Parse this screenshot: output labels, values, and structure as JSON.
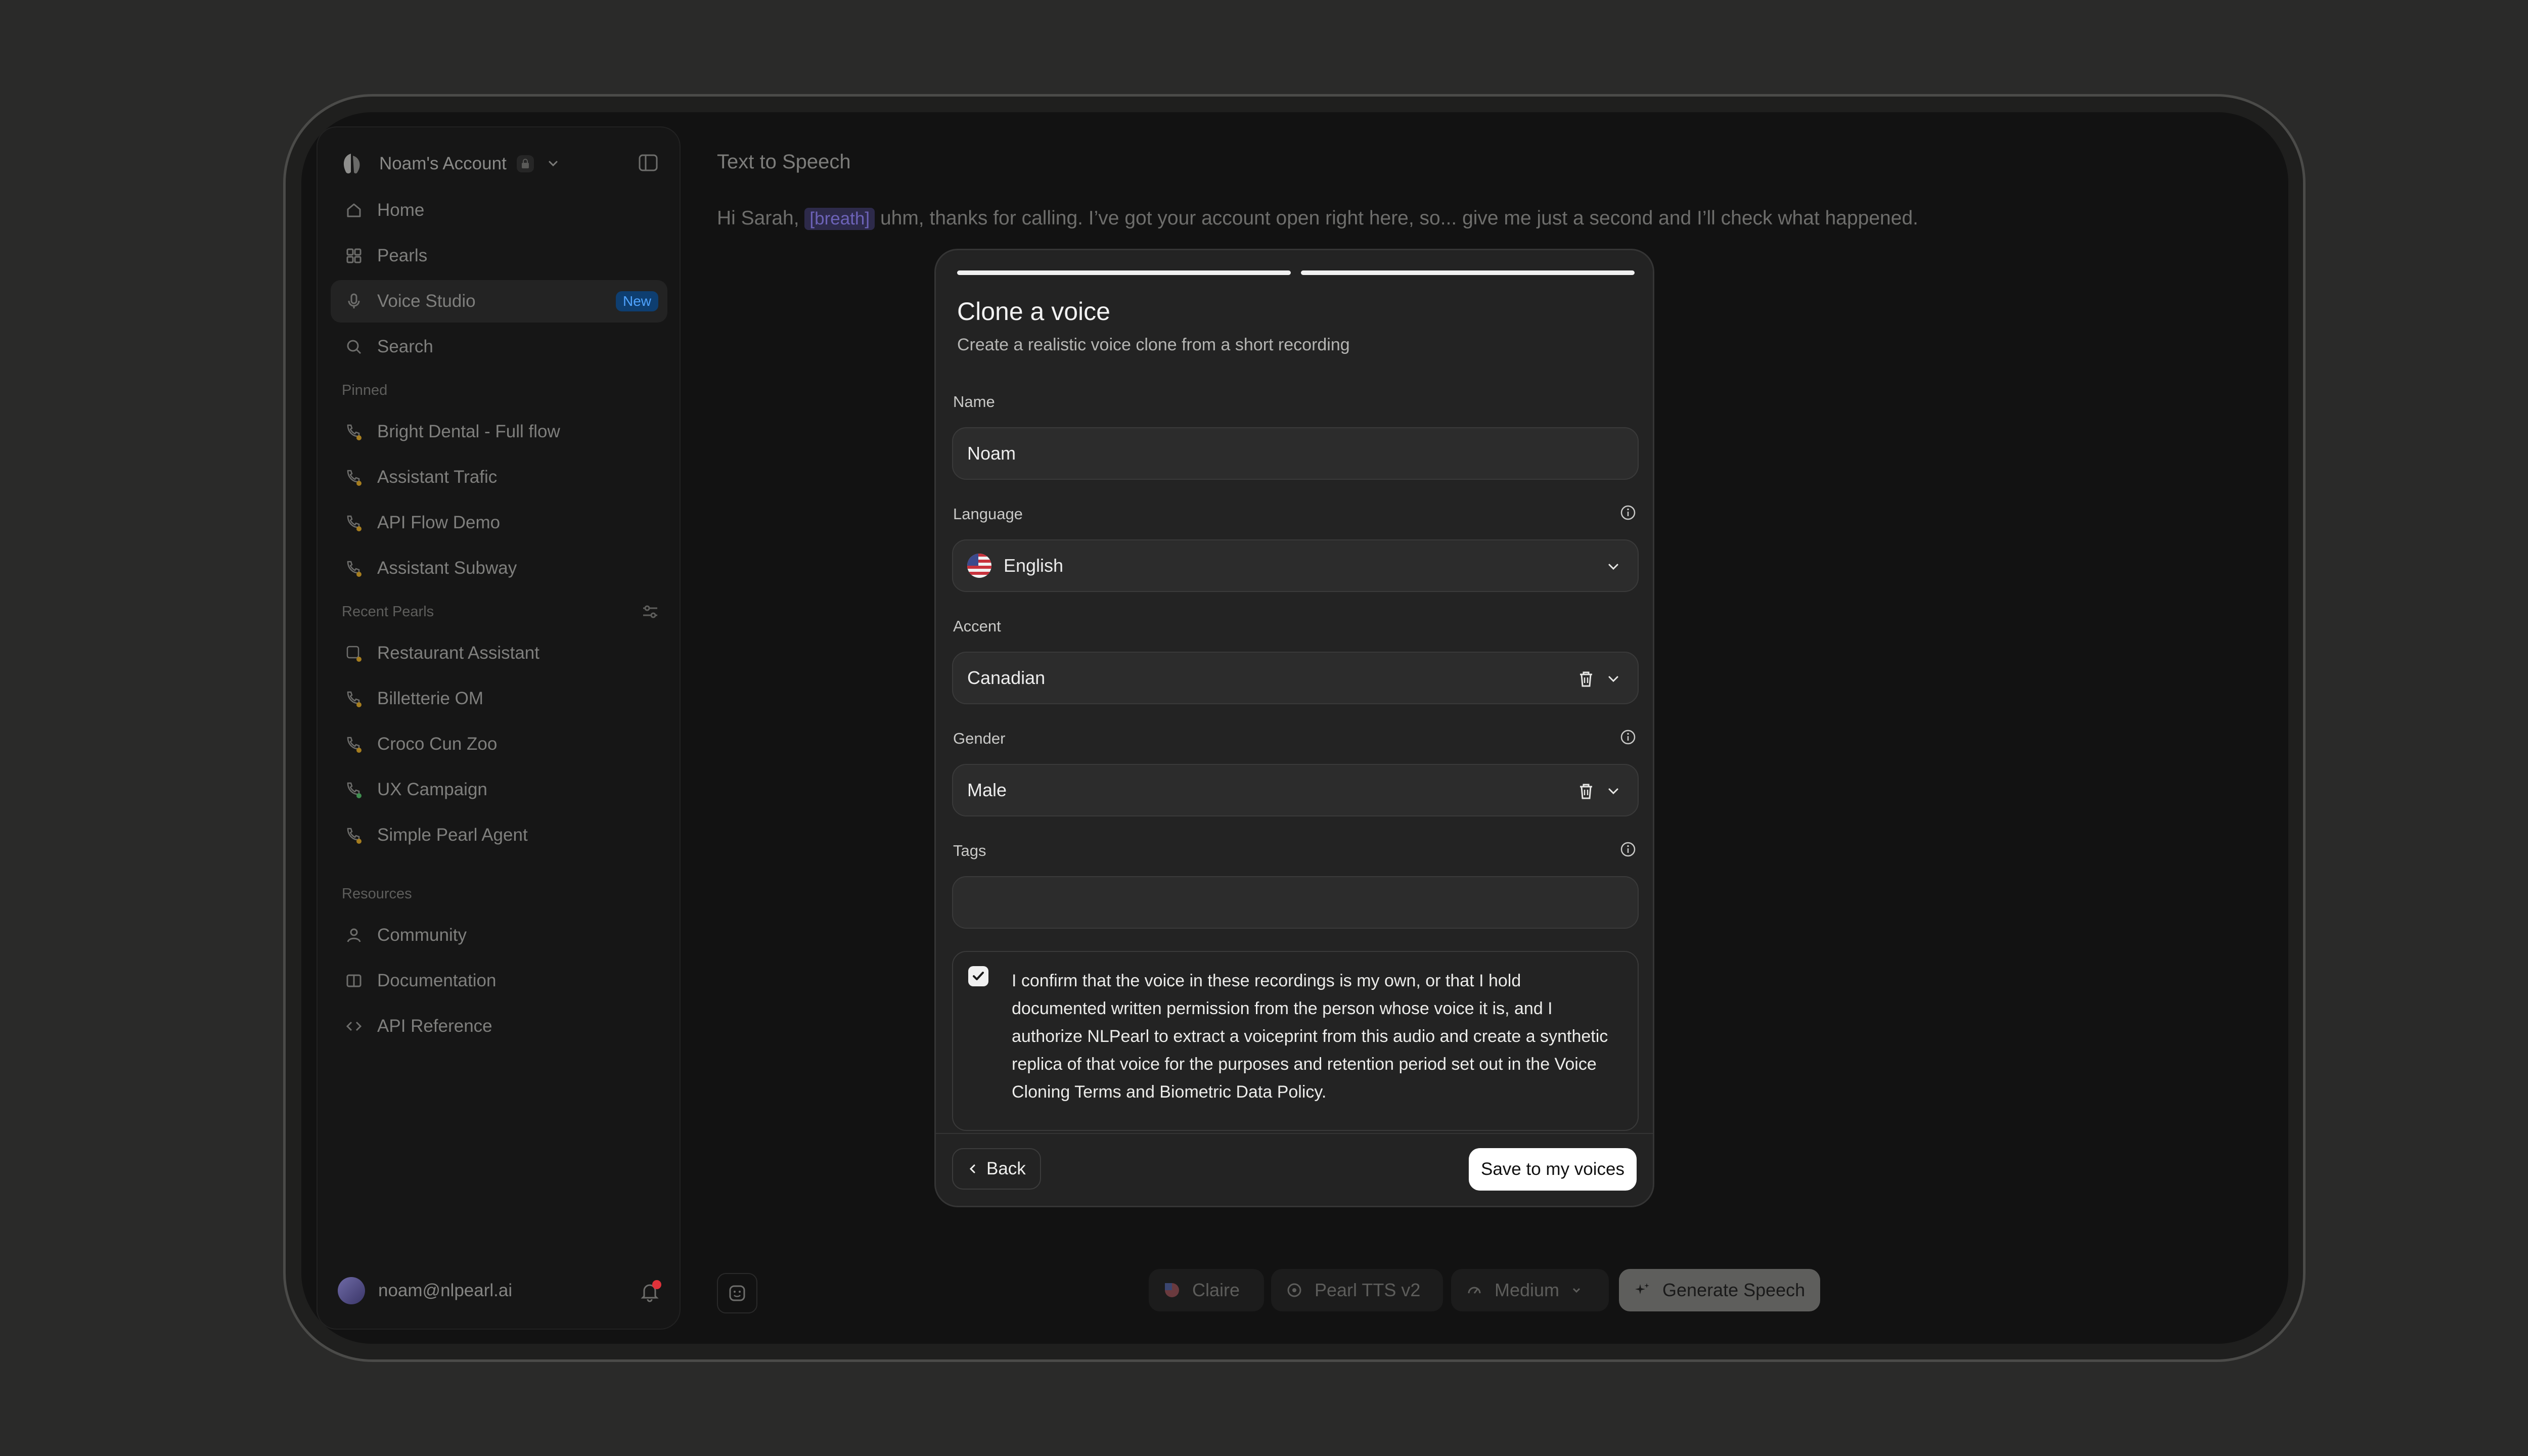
{
  "sidebar": {
    "account_name": "Noam's Account",
    "nav": [
      {
        "label": "Home",
        "icon": "home-icon"
      },
      {
        "label": "Pearls",
        "icon": "grid-icon"
      },
      {
        "label": "Voice Studio",
        "icon": "microphone-icon",
        "badge": "New",
        "active": true
      },
      {
        "label": "Search",
        "icon": "search-icon"
      }
    ],
    "pinned_label": "Pinned",
    "pinned": [
      "Bright Dental - Full flow",
      "Assistant Trafic",
      "API Flow Demo",
      "Assistant Subway"
    ],
    "recent_label": "Recent Pearls",
    "recent": [
      "Restaurant Assistant",
      "Billetterie OM",
      "Croco Cun Zoo",
      "UX Campaign",
      "Simple Pearl Agent"
    ],
    "resources_label": "Resources",
    "resources": [
      {
        "label": "Community",
        "icon": "community-icon"
      },
      {
        "label": "Documentation",
        "icon": "book-icon"
      },
      {
        "label": "API Reference",
        "icon": "code-icon"
      }
    ],
    "user_email": "noam@nlpearl.ai"
  },
  "main": {
    "title": "Text to Speech",
    "text_before": "Hi Sarah, ",
    "tag": "[breath]",
    "text_after": " uhm, thanks for calling. I’ve got your account open right here, so... give me just a second and I’ll check what happened."
  },
  "toolbar": {
    "voice": "Claire",
    "model": "Pearl TTS v2",
    "quality": "Medium",
    "generate": "Generate Speech"
  },
  "modal": {
    "title": "Clone a voice",
    "subtitle": "Create a realistic voice clone from a short recording",
    "progress_steps": 2,
    "progress_complete": 2,
    "name_label": "Name",
    "name_value": "Noam",
    "language_label": "Language",
    "language_value": "English",
    "accent_label": "Accent",
    "accent_value": "Canadian",
    "gender_label": "Gender",
    "gender_value": "Male",
    "tags_label": "Tags",
    "tags_value": "",
    "consent_checked": true,
    "consent_text": "I confirm that the voice in these recordings is my own, or that I hold documented written permission from the person whose voice it is, and I authorize NLPearl to extract a voiceprint from this audio and create a synthetic replica of that voice for the purposes and retention period set out in the Voice Cloning Terms and Biometric Data Policy.",
    "back_label": "Back",
    "save_label": "Save to my voices"
  },
  "colors": {
    "background": "#2a2a29",
    "modal": "#232323",
    "primary_button": "#ffffff",
    "badge_new": "#4fa3ff",
    "notification_dot": "#e0323a"
  }
}
